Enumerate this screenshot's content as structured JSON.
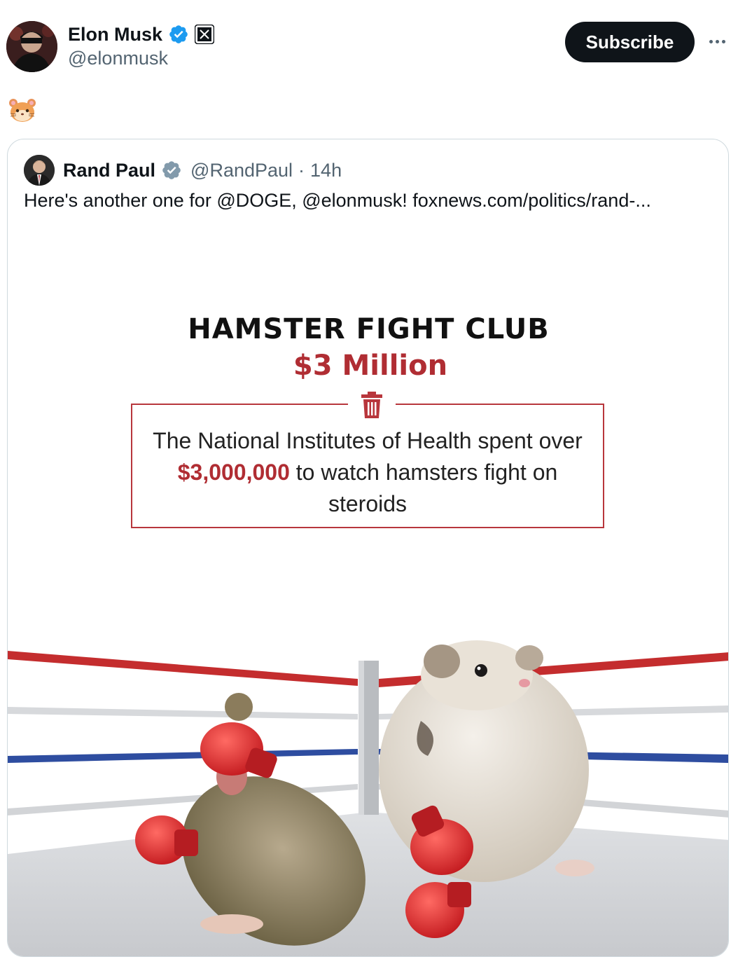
{
  "post": {
    "author": {
      "display_name": "Elon Musk",
      "handle": "@elonmusk",
      "verified_icon": "verified-badge-icon",
      "affiliation_icon": "x-logo-icon"
    },
    "subscribe_label": "Subscribe",
    "more_icon": "more-horizontal-icon",
    "text_emoji": "hamster-face-emoji"
  },
  "quoted_post": {
    "author": {
      "display_name": "Rand Paul",
      "handle": "@RandPaul",
      "separator": "·",
      "time": "14h",
      "verified_icon": "verified-badge-gray-icon"
    },
    "text": "Here's another one for @DOGE, @elonmusk! foxnews.com/politics/rand-...",
    "media": {
      "title": "HAMSTER FIGHT CLUB",
      "amount": "$3 Million",
      "icon": "trash-can-icon",
      "body_prefix": "The National Institutes of Health spent over ",
      "body_highlight": "$3,000,000",
      "body_suffix": " to watch hamsters fight on steroids",
      "scene": "two hamsters wearing red boxing gloves in a boxing ring"
    }
  },
  "colors": {
    "accent_red": "#b02d33",
    "verified_blue": "#1d9bf0",
    "text_primary": "#0f1419",
    "text_secondary": "#536471",
    "border": "#cfd9de"
  }
}
